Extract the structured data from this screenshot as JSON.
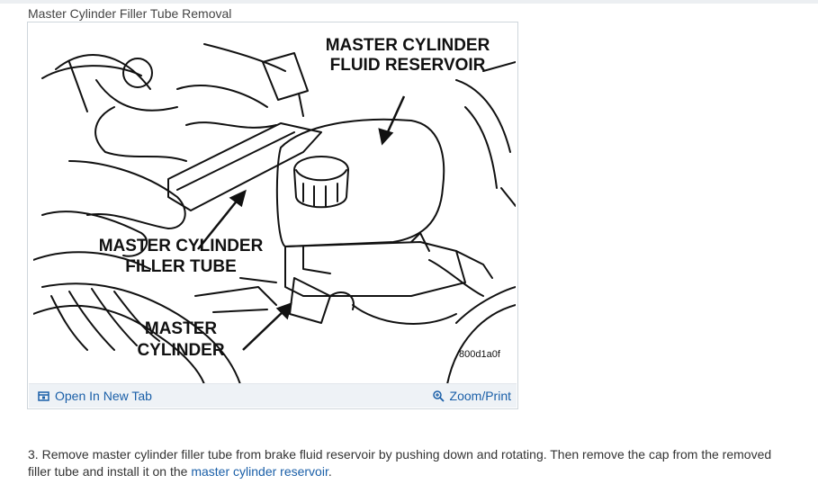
{
  "caption": "Master Cylinder Filler Tube Removal",
  "figure": {
    "labels": {
      "reservoir_line1": "MASTER CYLINDER",
      "reservoir_line2": "FLUID RESERVOIR",
      "filler_line1": "MASTER CYLINDER",
      "filler_line2": "FILLER TUBE",
      "master_line1": "MASTER",
      "master_line2": "CYLINDER",
      "code": "800d1a0f"
    }
  },
  "toolbar": {
    "open_label": "Open In New Tab",
    "zoom_label": "Zoom/Print",
    "open_icon": "open-in-new-tab-icon",
    "zoom_icon": "zoom-icon"
  },
  "step": {
    "number": "3.",
    "text": "Remove master cylinder filler tube from brake fluid reservoir by pushing down and rotating. Then remove the cap from the removed filler tube and install it on the",
    "link": "master cylinder reservoir",
    "end": "."
  },
  "colors": {
    "link": "#1a5fa8",
    "toolbar_bg": "#eef2f6"
  }
}
